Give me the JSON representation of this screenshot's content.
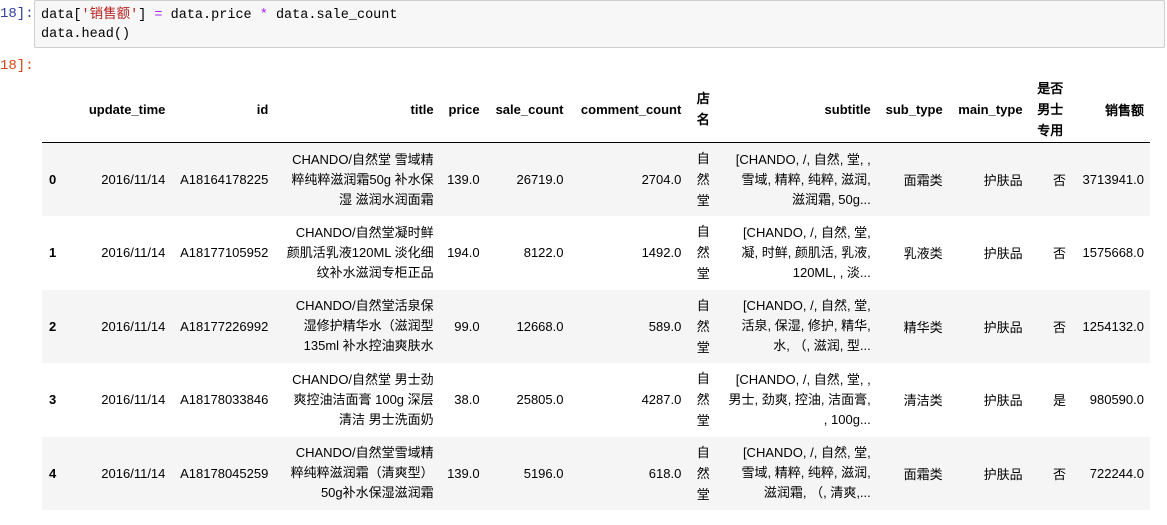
{
  "prompts": {
    "input": "18]:",
    "output": "18]:"
  },
  "code": {
    "line1_a": "data[",
    "line1_str": "'销售额'",
    "line1_b": "] ",
    "line1_eq": "=",
    "line1_c": " data.price ",
    "line1_op": "*",
    "line1_d": " data.sale_count",
    "line2": "data.head()"
  },
  "table": {
    "columns": [
      "",
      "update_time",
      "id",
      "title",
      "price",
      "sale_count",
      "comment_count",
      "店名",
      "subtitle",
      "sub_type",
      "main_type",
      "是否男士专用",
      "销售额"
    ],
    "rows": [
      {
        "index": "0",
        "update_time": "2016/11/14",
        "id": "A18164178225",
        "title": [
          "CHANDO/自然堂 雪域精",
          "粹纯粹滋润霜50g 补水保",
          "湿 滋润水润面霜"
        ],
        "price": "139.0",
        "sale_count": "26719.0",
        "comment_count": "2704.0",
        "shop": [
          "自",
          "然",
          "堂"
        ],
        "subtitle": [
          "[CHANDO, /, 自然, 堂, ,",
          "雪域, 精粹, 纯粹, 滋润,",
          "滋润霜, 50g..."
        ],
        "sub_type": "面霜类",
        "main_type": "护肤品",
        "men_only": "否",
        "sales": "3713941.0"
      },
      {
        "index": "1",
        "update_time": "2016/11/14",
        "id": "A18177105952",
        "title": [
          "CHANDO/自然堂凝时鲜",
          "颜肌活乳液120ML 淡化细",
          "纹补水滋润专柜正品"
        ],
        "price": "194.0",
        "sale_count": "8122.0",
        "comment_count": "1492.0",
        "shop": [
          "自",
          "然",
          "堂"
        ],
        "subtitle": [
          "[CHANDO, /, 自然, 堂,",
          "凝, 时鲜, 颜肌活, 乳液,",
          "120ML, , 淡..."
        ],
        "sub_type": "乳液类",
        "main_type": "护肤品",
        "men_only": "否",
        "sales": "1575668.0"
      },
      {
        "index": "2",
        "update_time": "2016/11/14",
        "id": "A18177226992",
        "title": [
          "CHANDO/自然堂活泉保",
          "湿修护精华水（滋润型",
          "135ml 补水控油爽肤水"
        ],
        "price": "99.0",
        "sale_count": "12668.0",
        "comment_count": "589.0",
        "shop": [
          "自",
          "然",
          "堂"
        ],
        "subtitle": [
          "[CHANDO, /, 自然, 堂,",
          "活泉, 保湿, 修护, 精华,",
          "水, （, 滋润, 型..."
        ],
        "sub_type": "精华类",
        "main_type": "护肤品",
        "men_only": "否",
        "sales": "1254132.0"
      },
      {
        "index": "3",
        "update_time": "2016/11/14",
        "id": "A18178033846",
        "title": [
          "CHANDO/自然堂 男士劲",
          "爽控油洁面膏 100g 深层",
          "清洁 男士洗面奶"
        ],
        "price": "38.0",
        "sale_count": "25805.0",
        "comment_count": "4287.0",
        "shop": [
          "自",
          "然",
          "堂"
        ],
        "subtitle": [
          "[CHANDO, /, 自然, 堂, ,",
          "男士, 劲爽, 控油, 洁面膏,",
          ", 100g..."
        ],
        "sub_type": "清洁类",
        "main_type": "护肤品",
        "men_only": "是",
        "sales": "980590.0"
      },
      {
        "index": "4",
        "update_time": "2016/11/14",
        "id": "A18178045259",
        "title": [
          "CHANDO/自然堂雪域精",
          "粹纯粹滋润霜（清爽型）",
          "50g补水保湿滋润霜"
        ],
        "price": "139.0",
        "sale_count": "5196.0",
        "comment_count": "618.0",
        "shop": [
          "自",
          "然",
          "堂"
        ],
        "subtitle": [
          "[CHANDO, /, 自然, 堂,",
          "雪域, 精粹, 纯粹, 滋润,",
          "滋润霜, （, 清爽,..."
        ],
        "sub_type": "面霜类",
        "main_type": "护肤品",
        "men_only": "否",
        "sales": "722244.0"
      }
    ]
  }
}
